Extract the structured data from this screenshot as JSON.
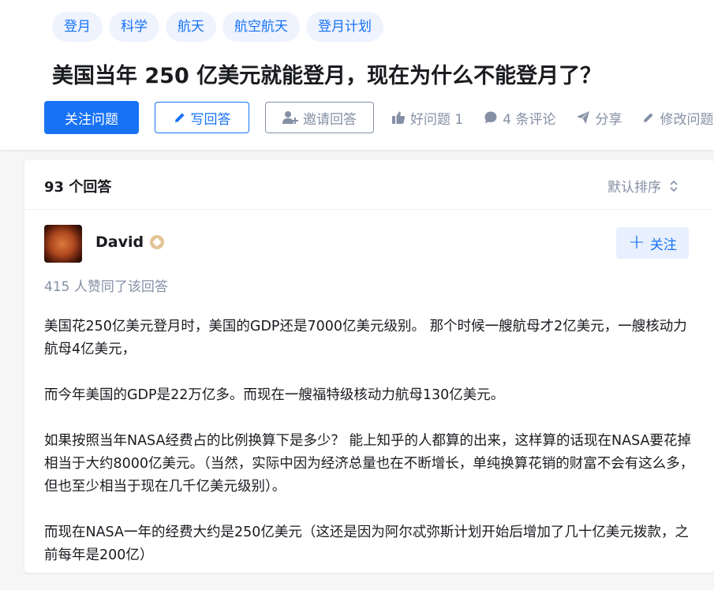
{
  "topics": [
    "登月",
    "科学",
    "航天",
    "航空航天",
    "登月计划"
  ],
  "question": {
    "title": "美国当年 250 亿美元就能登月，现在为什么不能登月了？"
  },
  "actions": {
    "follow_label": "关注问题",
    "write_label": "写回答",
    "invite_label": "邀请回答",
    "good_question_label": "好问题 1",
    "comments_label": "4 条评论",
    "share_label": "分享",
    "edit_label": "修改问题"
  },
  "answers": {
    "count_label": "93 个回答",
    "sort_label": "默认排序"
  },
  "answer": {
    "author_name": "David",
    "follow_label": "关注",
    "votes_label": "415 人赞同了该回答",
    "paragraphs": [
      "美国花250亿美元登月时，美国的GDP还是7000亿美元级别。 那个时候一艘航母才2亿美元，一艘核动力航母4亿美元，",
      "而今年美国的GDP是22万亿多。而现在一艘福特级核动力航母130亿美元。",
      "如果按照当年NASA经费占的比例换算下是多少？ 能上知乎的人都算的出来，这样算的话现在NASA要花掉相当于大约8000亿美元。（当然，实际中因为经济总量也在不断增长，单纯换算花销的财富不会有这么多，但也至少相当于现在几千亿美元级别）。",
      "而现在NASA一年的经费大约是250亿美元（这还是因为阿尔忒弥斯计划开始后增加了几十亿美元拨款，之前每年是200亿）"
    ]
  },
  "colors": {
    "brand": "#1772f6",
    "muted": "#8590a6",
    "text": "#191b1f"
  }
}
